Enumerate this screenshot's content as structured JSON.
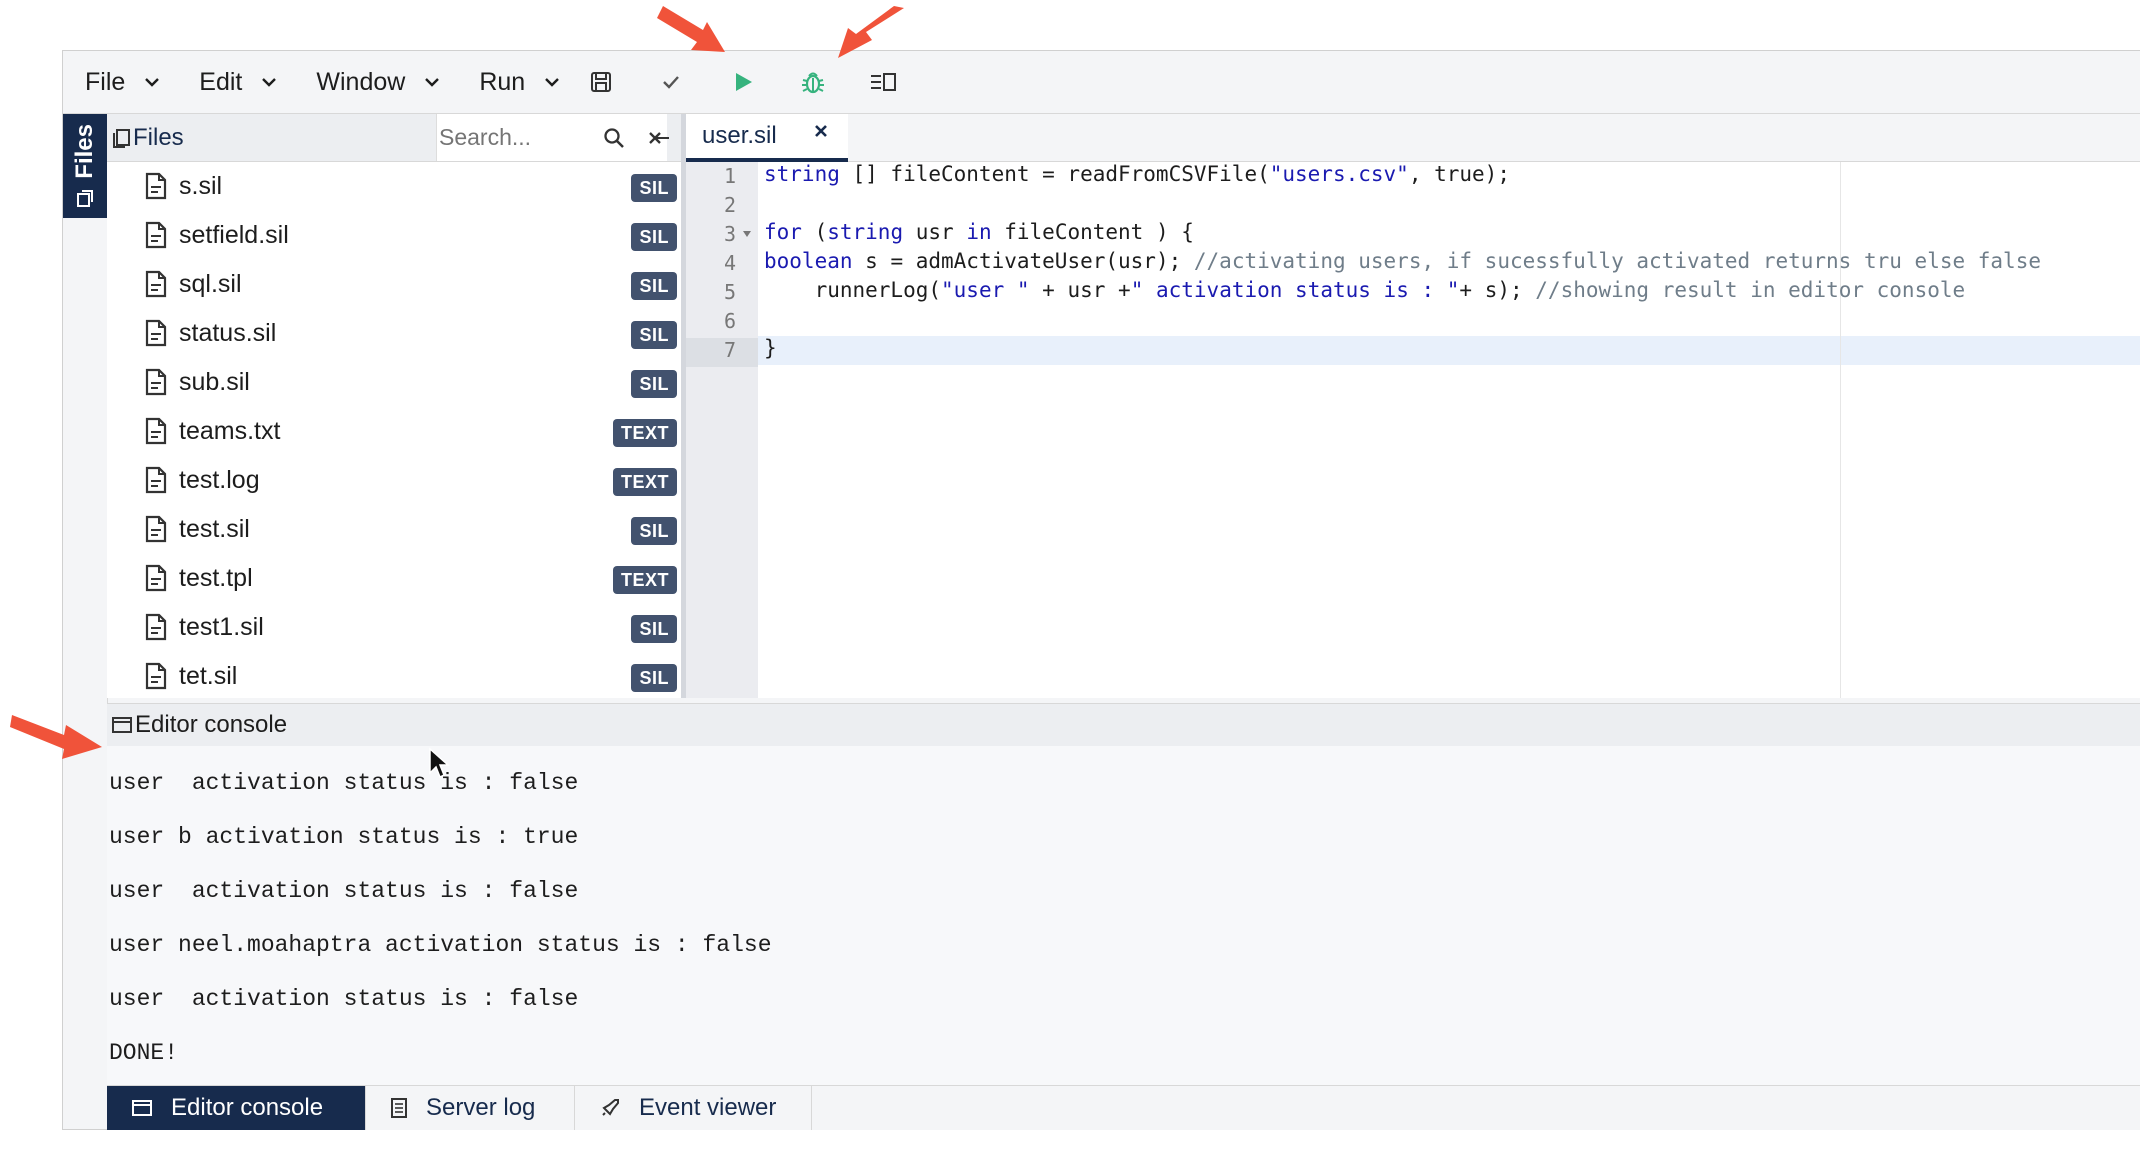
{
  "toolbar": {
    "menus": [
      {
        "label": "File"
      },
      {
        "label": "Edit"
      },
      {
        "label": "Window"
      },
      {
        "label": "Run"
      }
    ],
    "icons": [
      "save-icon",
      "check-icon",
      "run-icon",
      "debug-icon",
      "layout-icon"
    ],
    "accent_run": "#36b37e"
  },
  "sidebar": {
    "vertical_tab_label": "Files"
  },
  "files_panel": {
    "title": "Files",
    "search_placeholder": "Search...",
    "files": [
      {
        "name": "s.sil",
        "badge": "SIL"
      },
      {
        "name": "setfield.sil",
        "badge": "SIL"
      },
      {
        "name": "sql.sil",
        "badge": "SIL"
      },
      {
        "name": "status.sil",
        "badge": "SIL"
      },
      {
        "name": "sub.sil",
        "badge": "SIL"
      },
      {
        "name": "teams.txt",
        "badge": "TEXT"
      },
      {
        "name": "test.log",
        "badge": "TEXT"
      },
      {
        "name": "test.sil",
        "badge": "SIL"
      },
      {
        "name": "test.tpl",
        "badge": "TEXT"
      },
      {
        "name": "test1.sil",
        "badge": "SIL"
      },
      {
        "name": "tet.sil",
        "badge": "SIL"
      }
    ]
  },
  "editor": {
    "tab_label": "user.sil",
    "line_numbers": [
      "1",
      "2",
      "3",
      "4",
      "5",
      "6",
      "7"
    ],
    "lines": {
      "l1_type": "string",
      "l1_rest": " [] fileContent = readFromCSVFile(",
      "l1_str": "\"users.csv\"",
      "l1_end": ", true);",
      "l3_kw": "for",
      "l3_mid": " (",
      "l3_type": "string",
      "l3_mid2": " usr ",
      "l3_in": "in",
      "l3_end": " fileContent ) {",
      "l4_type": "boolean",
      "l4_rest": " s = admActivateUser(usr); ",
      "l4_comment": "//activating users, if sucessfully activated returns tru else false",
      "l5_pre": "    runnerLog(",
      "l5_str1": "\"user \"",
      "l5_mid": " + usr +",
      "l5_str2": "\" activation status is : \"",
      "l5_end": "+ s); ",
      "l5_comment": "//showing result in editor console",
      "l7": "}"
    }
  },
  "console": {
    "title": "Editor console",
    "lines": [
      "user  activation status is : false",
      "user b activation status is : true",
      "user  activation status is : false",
      "user neel.moahaptra activation status is : false",
      "user  activation status is : false",
      "DONE!"
    ]
  },
  "bottom_tabs": [
    {
      "label": "Editor console",
      "active": true
    },
    {
      "label": "Server log",
      "active": false
    },
    {
      "label": "Event viewer",
      "active": false
    }
  ],
  "annotation_color": "#f0533a"
}
